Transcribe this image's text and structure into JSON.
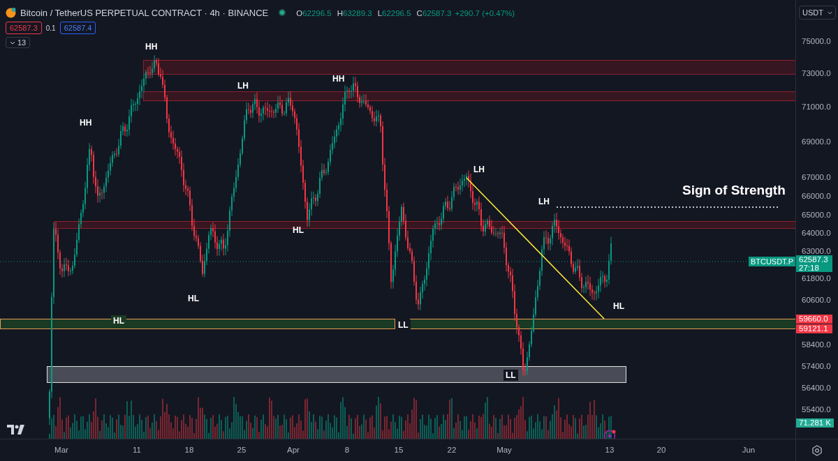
{
  "header": {
    "symbol": "Bitcoin / TetherUS PERPETUAL CONTRACT · 4h · BINANCE",
    "market_open": true,
    "ohlc": [
      {
        "key": "O",
        "value": "62296.5"
      },
      {
        "key": "H",
        "value": "63289.3"
      },
      {
        "key": "L",
        "value": "62296.5"
      },
      {
        "key": "C",
        "value": "62587.3"
      }
    ],
    "change": "+290.7 (+0.47%)"
  },
  "trade": {
    "sell": "62587.3",
    "spread": "0.1",
    "buy": "62587.4"
  },
  "indicators_toggle": {
    "count": "13"
  },
  "currency": "USDT",
  "price_axis": [
    "75000.0",
    "73000.0",
    "71000.0",
    "69000.0",
    "67000.0",
    "66000.0",
    "65000.0",
    "64000.0",
    "63000.0",
    "61800.0",
    "60600.0",
    "58400.0",
    "57400.0",
    "56400.0",
    "55400.0"
  ],
  "last_price": {
    "symbol": "BTCUSDT.P",
    "price": "62587.3",
    "countdown": "27:18"
  },
  "level_badges": [
    "59660.0",
    "59121.1"
  ],
  "volume_badge": "71.281 K",
  "time_axis": [
    "Mar",
    "11",
    "18",
    "25",
    "Apr",
    "8",
    "15",
    "22",
    "May",
    "13",
    "20",
    "Jun"
  ],
  "swing_labels": [
    {
      "text": "HH"
    },
    {
      "text": "HH"
    },
    {
      "text": "LH"
    },
    {
      "text": "HH"
    },
    {
      "text": "LH"
    },
    {
      "text": "LH"
    },
    {
      "text": "HL"
    },
    {
      "text": "HL"
    },
    {
      "text": "HL"
    },
    {
      "text": "HL"
    },
    {
      "text": "LL"
    },
    {
      "text": "LL"
    }
  ],
  "headline": "Sign of Strength"
}
